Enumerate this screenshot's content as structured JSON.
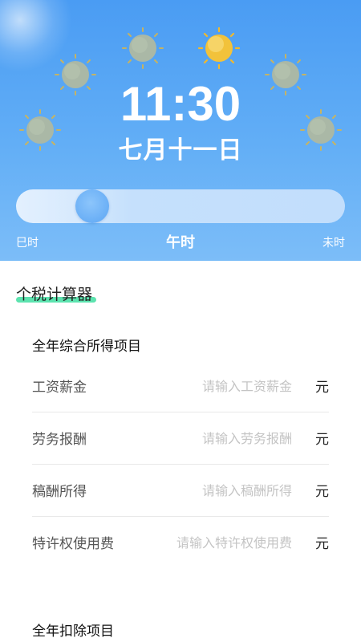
{
  "header": {
    "time": "11:30",
    "date": "七月十一日",
    "slider": {
      "left_label": "巳时",
      "current_label": "午时",
      "right_label": "未时",
      "position": 0.2
    },
    "sun_icons": [
      "sun-icon",
      "sun-icon",
      "sun-icon",
      "sun-icon-active",
      "sun-icon",
      "sun-icon"
    ]
  },
  "calculator": {
    "title": "个税计算器",
    "income_section": {
      "title": "全年综合所得项目",
      "rows": [
        {
          "label": "工资薪金",
          "placeholder": "请输入工资薪金",
          "unit": "元"
        },
        {
          "label": "劳务报酬",
          "placeholder": "请输入劳务报酬",
          "unit": "元"
        },
        {
          "label": "稿酬所得",
          "placeholder": "请输入稿酬所得",
          "unit": "元"
        },
        {
          "label": "特许权使用费",
          "placeholder": "请输入特许权使用费",
          "unit": "元"
        }
      ]
    },
    "deduction_section": {
      "title": "全年扣除项目"
    }
  },
  "colors": {
    "header_blue": "#4a9cf3",
    "accent_green": "#4be0a6",
    "active_sun": "#f2c23b"
  }
}
